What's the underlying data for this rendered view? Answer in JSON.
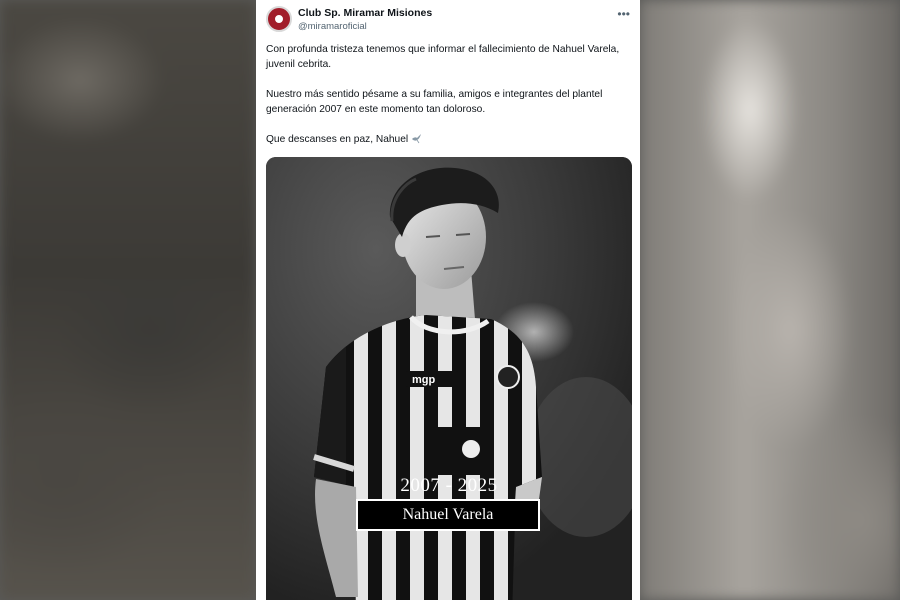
{
  "account": {
    "name": "Club Sp. Miramar Misiones",
    "handle": "@miramaroficial"
  },
  "tweet": {
    "paragraphs": [
      "Con profunda tristeza tenemos que informar el fallecimiento de Nahuel Varela, juvenil cebrita.",
      "Nuestro más sentido pésame a su familia, amigos e integrantes del plantel generación 2007 en este momento tan doloroso.",
      "Que descanses en paz, Nahuel"
    ]
  },
  "image": {
    "years": "2007 - 2025",
    "name": "Nahuel Varela",
    "jersey_sponsor": "mgp"
  },
  "icons": {
    "more": "more-options-icon",
    "dove": "dove-icon",
    "avatar": "club-crest-avatar"
  },
  "colors": {
    "brand": "#a11d2a",
    "text": "#0f1419",
    "muted": "#536471"
  }
}
